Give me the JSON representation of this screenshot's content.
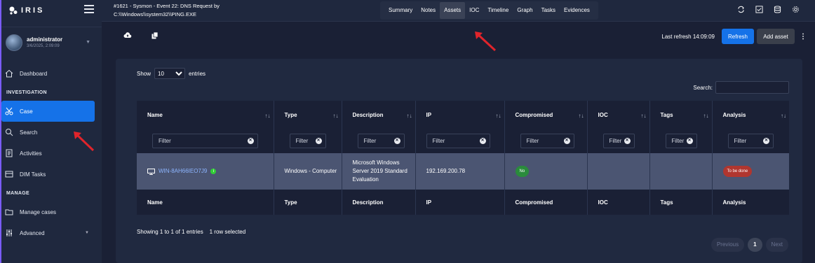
{
  "app": {
    "logo_text": "IRIS"
  },
  "user": {
    "name": "administrator",
    "date": "3/6/2025, 2:09:09"
  },
  "sidebar": {
    "items": [
      {
        "label": "Dashboard"
      },
      {
        "section": "INVESTIGATION"
      },
      {
        "label": "Case"
      },
      {
        "label": "Search"
      },
      {
        "label": "Activities"
      },
      {
        "label": "DIM Tasks"
      },
      {
        "section": "MANAGE"
      },
      {
        "label": "Manage cases"
      },
      {
        "label": "Advanced"
      }
    ]
  },
  "header": {
    "case_title_line1": "#1621 - Sysmon - Event 22: DNS Request by",
    "case_title_line2": "C:\\\\Windows\\\\system32\\\\PING.EXE",
    "tabs": [
      "Summary",
      "Notes",
      "Assets",
      "IOC",
      "Timeline",
      "Graph",
      "Tasks",
      "Evidences"
    ],
    "active_tab": "Assets"
  },
  "toolbar": {
    "last_refresh": "Last refresh 14:09:09",
    "refresh_label": "Refresh",
    "add_asset_label": "Add asset"
  },
  "table": {
    "show_label": "Show",
    "entries_label": "entries",
    "page_length": "10",
    "search_label": "Search:",
    "filter_placeholder": "Filter",
    "columns": [
      "Name",
      "Type",
      "Description",
      "IP",
      "Compromised",
      "IOC",
      "Tags",
      "Analysis"
    ],
    "rows": [
      {
        "name": "WIN-8AH66IEO7J9",
        "type": "Windows - Computer",
        "description": "Microsoft Windows Server 2019 Standard Evaluation",
        "ip": "192.169.200.78",
        "compromised": "No",
        "ioc": "",
        "tags": "",
        "analysis": "To be done"
      }
    ],
    "info": "Showing 1 to 1 of 1 entries",
    "selected_info": "1 row selected"
  },
  "pagination": {
    "previous": "Previous",
    "current": "1",
    "next": "Next"
  },
  "colors": {
    "accent": "#1572e8",
    "sidebar_bg": "#1f283e",
    "page_bg": "#1a2035",
    "annotation_arrow": "#e0242b"
  }
}
